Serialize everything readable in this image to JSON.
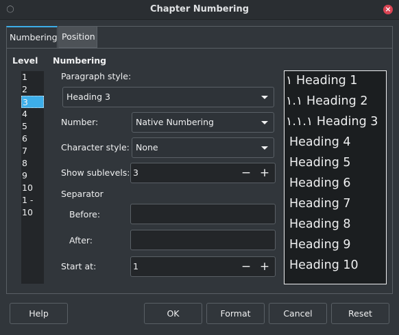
{
  "window": {
    "title": "Chapter Numbering",
    "close_icon": "close-icon",
    "pin_icon": "pin-icon"
  },
  "tabs": [
    {
      "label": "Numbering"
    },
    {
      "label": "Position"
    }
  ],
  "level": {
    "heading": "Level",
    "items": [
      "1",
      "2",
      "3",
      "4",
      "5",
      "6",
      "7",
      "8",
      "9",
      "10",
      "1 - 10"
    ],
    "selected": "3"
  },
  "numbering": {
    "heading": "Numbering",
    "paragraph_style_label": "Paragraph style:",
    "paragraph_style_value": "Heading 3",
    "number_label": "Number:",
    "number_value": "Native Numbering",
    "character_style_label": "Character style:",
    "character_style_value": "None",
    "show_sublevels_label": "Show sublevels:",
    "show_sublevels_value": "3",
    "separator_heading": "Separator",
    "before_label": "Before:",
    "before_value": "",
    "after_label": "After:",
    "after_value": "",
    "start_at_label": "Start at:",
    "start_at_value": "1",
    "minus": "−",
    "plus": "+"
  },
  "preview": [
    "١ Heading 1",
    "١.١ Heading 2",
    "١.١.١ Heading 3",
    "Heading 4",
    "Heading 5",
    "Heading 6",
    "Heading 7",
    "Heading 8",
    "Heading 9",
    "Heading 10"
  ],
  "buttons": {
    "help": "Help",
    "ok": "OK",
    "format": "Format",
    "cancel": "Cancel",
    "reset": "Reset"
  },
  "colors": {
    "accent": "#3daee9",
    "close": "#da4453",
    "background": "#31363b"
  }
}
